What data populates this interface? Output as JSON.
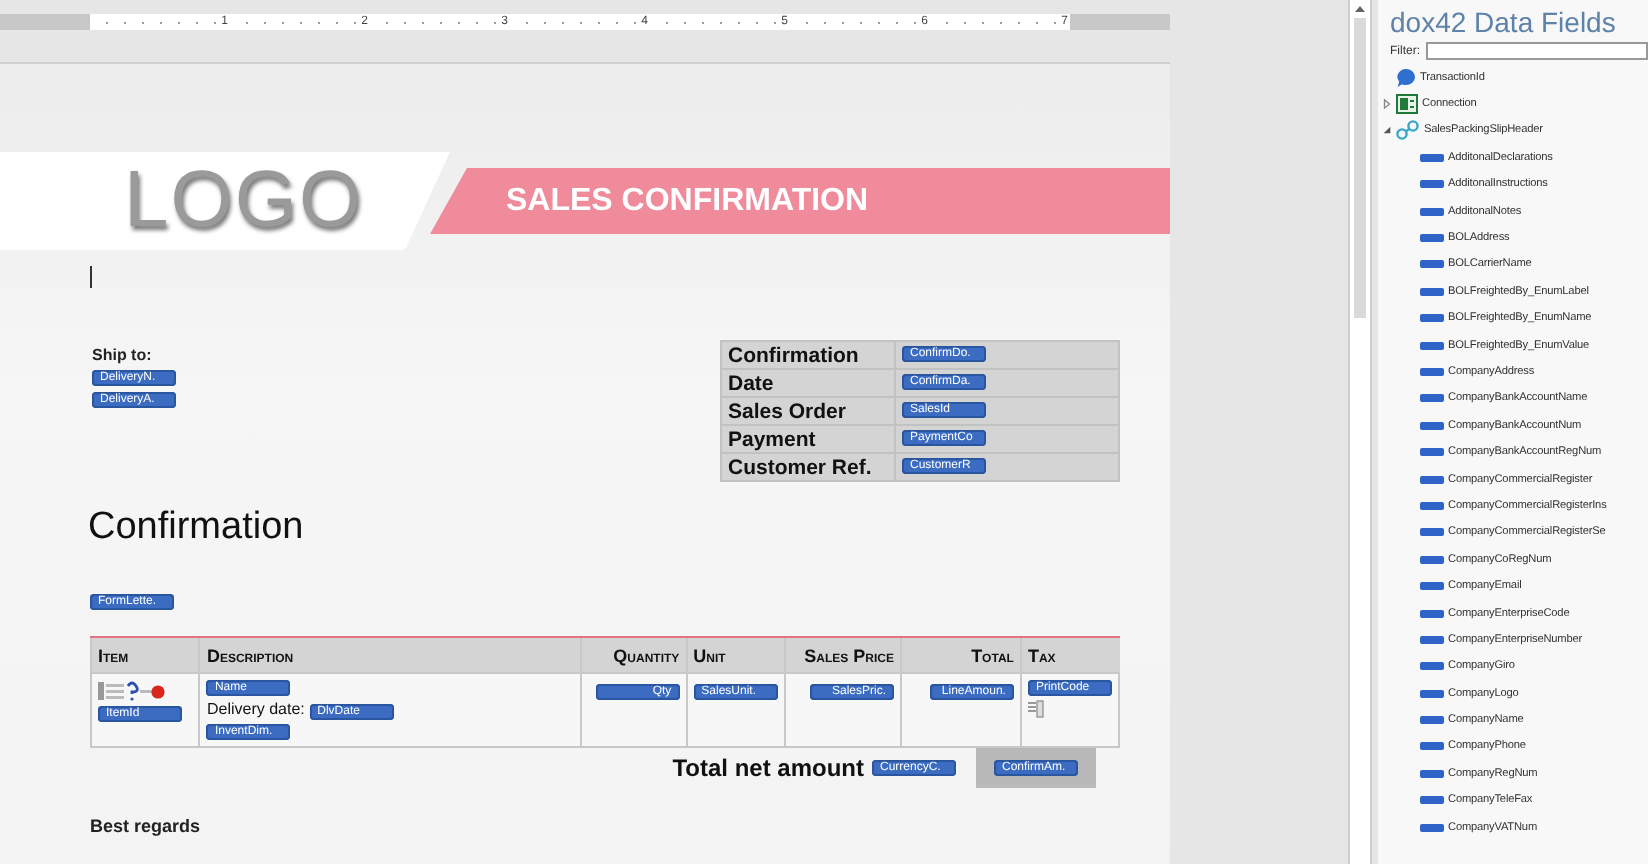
{
  "ruler": {
    "marks": [
      "1",
      "2",
      "3",
      "4",
      "5",
      "6",
      "7"
    ]
  },
  "document": {
    "logo": "LOGO",
    "title": "SALES CONFIRMATION",
    "ship_to": {
      "label": "Ship to:",
      "fields": [
        "DeliveryN.",
        "DeliveryA."
      ]
    },
    "info_table": [
      {
        "label": "Confirmation",
        "field": "ConfirmDo."
      },
      {
        "label": "Date",
        "field": "ConfirmDa."
      },
      {
        "label": "Sales Order",
        "field": "SalesId"
      },
      {
        "label": "Payment",
        "field": "PaymentCo"
      },
      {
        "label": "Customer Ref.",
        "field": "CustomerR"
      }
    ],
    "heading": "Confirmation",
    "intro_field": "FormLette.",
    "lines_table": {
      "columns": [
        "Item",
        "Description",
        "Quantity",
        "Unit",
        "Sales Price",
        "Total",
        "Tax"
      ],
      "row": {
        "item_field": "ItemId",
        "name_field": "Name",
        "delivery_label": "Delivery date:",
        "delivery_field": "DlvDate",
        "dimension_field": "InventDim.",
        "quantity_field": "Qty",
        "unit_field": "SalesUnit.",
        "price_field": "SalesPric.",
        "total_field": "LineAmoun.",
        "tax_field": "PrintCode"
      }
    },
    "total": {
      "label": "Total net amount",
      "currency_field": "CurrencyC.",
      "amount_field": "ConfirmAm."
    },
    "closing": "Best regards"
  },
  "data_fields_panel": {
    "title": "dox42 Data Fields",
    "filter_label": "Filter:",
    "tree": [
      {
        "label": "TransactionId",
        "kind": "transaction"
      },
      {
        "label": "Connection",
        "kind": "connection",
        "expanded": false
      },
      {
        "label": "SalesPackingSlipHeader",
        "kind": "table",
        "expanded": true,
        "children": [
          {
            "label": "AdditonalDeclarations",
            "kind": "field"
          },
          {
            "label": "AdditonalInstructions",
            "kind": "field"
          },
          {
            "label": "AdditonalNotes",
            "kind": "field"
          },
          {
            "label": "BOLAddress",
            "kind": "field"
          },
          {
            "label": "BOLCarrierName",
            "kind": "field"
          },
          {
            "label": "BOLFreightedBy_EnumLabel",
            "kind": "field"
          },
          {
            "label": "BOLFreightedBy_EnumName",
            "kind": "field"
          },
          {
            "label": "BOLFreightedBy_EnumValue",
            "kind": "field"
          },
          {
            "label": "CompanyAddress",
            "kind": "field"
          },
          {
            "label": "CompanyBankAccountName",
            "kind": "field"
          },
          {
            "label": "CompanyBankAccountNum",
            "kind": "field"
          },
          {
            "label": "CompanyBankAccountRegNum",
            "kind": "field"
          },
          {
            "label": "CompanyCommercialRegister",
            "kind": "field"
          },
          {
            "label": "CompanyCommercialRegisterIns",
            "kind": "field"
          },
          {
            "label": "CompanyCommercialRegisterSe",
            "kind": "field"
          },
          {
            "label": "CompanyCoRegNum",
            "kind": "field"
          },
          {
            "label": "CompanyEmail",
            "kind": "field"
          },
          {
            "label": "CompanyEnterpriseCode",
            "kind": "field"
          },
          {
            "label": "CompanyEnterpriseNumber",
            "kind": "field"
          },
          {
            "label": "CompanyGiro",
            "kind": "field"
          },
          {
            "label": "CompanyLogo",
            "kind": "field"
          },
          {
            "label": "CompanyName",
            "kind": "field"
          },
          {
            "label": "CompanyPhone",
            "kind": "field"
          },
          {
            "label": "CompanyRegNum",
            "kind": "field"
          },
          {
            "label": "CompanyTeleFax",
            "kind": "field"
          },
          {
            "label": "CompanyVATNum",
            "kind": "field"
          }
        ]
      }
    ]
  }
}
